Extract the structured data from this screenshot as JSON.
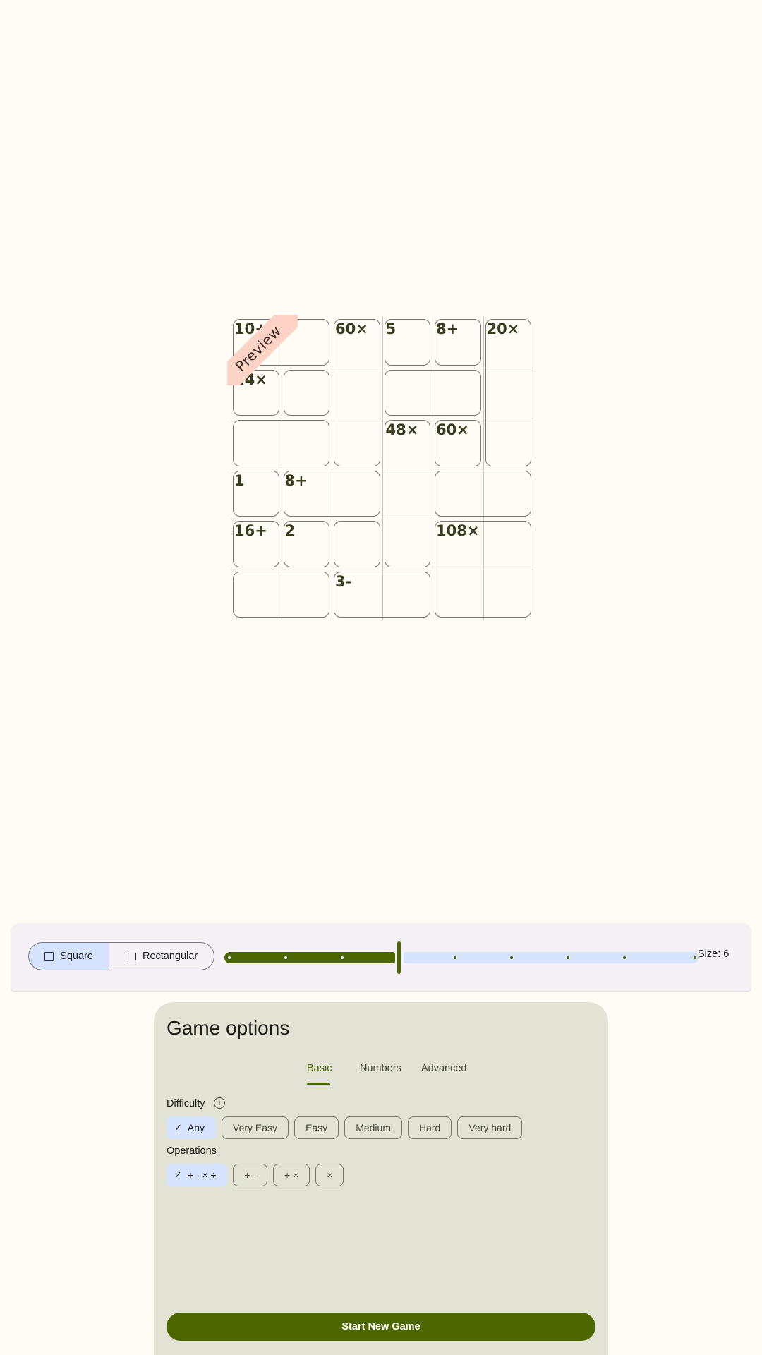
{
  "colors": {
    "background": "#fffcf5",
    "primary": "#4c6600",
    "selected_chip": "#d6e3ff",
    "options_sheet": "#e2e3d4",
    "preview_ribbon": "#fdd3c6",
    "clue_text": "#363d1f"
  },
  "puzzle": {
    "size": 6,
    "preview_label": "Preview",
    "clues": [
      "10+",
      "60×",
      "5",
      "8+",
      "20×",
      "24×",
      "48×",
      "60×",
      "1",
      "8+",
      "16+",
      "2",
      "108×",
      "3-"
    ]
  },
  "size_bar": {
    "shape_options": [
      {
        "label": "Square",
        "icon": "square-icon",
        "selected": true
      },
      {
        "label": "Rectangular",
        "icon": "rectangle-icon",
        "selected": false
      }
    ],
    "slider_steps": 9,
    "slider_selected_index": 3,
    "size_label": "Size: 6"
  },
  "options": {
    "title": "Game options",
    "tabs": [
      {
        "label": "Basic",
        "active": true
      },
      {
        "label": "Numbers",
        "active": false
      },
      {
        "label": "Advanced",
        "active": false
      }
    ],
    "difficulty": {
      "label": "Difficulty",
      "info_icon": "info-icon",
      "chips": [
        {
          "label": "Any",
          "selected": true
        },
        {
          "label": "Very Easy",
          "selected": false
        },
        {
          "label": "Easy",
          "selected": false
        },
        {
          "label": "Medium",
          "selected": false
        },
        {
          "label": "Hard",
          "selected": false
        },
        {
          "label": "Very hard",
          "selected": false
        }
      ]
    },
    "operations": {
      "label": "Operations",
      "chips": [
        {
          "label": "+ - × ÷",
          "selected": true
        },
        {
          "label": "+ -",
          "selected": false
        },
        {
          "label": "+ ×",
          "selected": false
        },
        {
          "label": "×",
          "selected": false
        }
      ]
    },
    "start_button": "Start New Game"
  }
}
